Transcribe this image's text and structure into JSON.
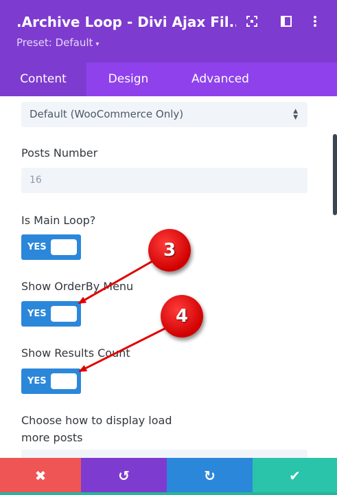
{
  "header": {
    "title": ".Archive Loop - Divi Ajax Fil...",
    "preset_label": "Preset: Default",
    "preset_caret": "▾",
    "icons": [
      "focus-icon",
      "sidebar-toggle-icon",
      "more-vertical-icon"
    ],
    "background": "#7e3bd0"
  },
  "tabs": [
    {
      "label": "Content",
      "active": true
    },
    {
      "label": "Design",
      "active": false
    },
    {
      "label": "Advanced",
      "active": false
    }
  ],
  "fields": {
    "source_select_value": "Default (WooCommerce Only)",
    "posts_number_label": "Posts Number",
    "posts_number_value": "16",
    "main_loop_label": "Is Main Loop?",
    "main_loop_toggle": "YES",
    "orderby_label": "Show OrderBy Menu",
    "orderby_toggle": "YES",
    "results_count_label": "Show Results Count",
    "results_count_toggle": "YES",
    "load_more_label_line1": "Choose how to display load",
    "load_more_label_line2": "more posts"
  },
  "annotations": [
    {
      "number": "3"
    },
    {
      "number": "4"
    }
  ],
  "bottom_bar": [
    {
      "name": "cancel",
      "icon": "✖",
      "color": "#ef5555"
    },
    {
      "name": "undo",
      "icon": "↺",
      "color": "#7e3bd0"
    },
    {
      "name": "redo",
      "icon": "↻",
      "color": "#2b87da"
    },
    {
      "name": "save",
      "icon": "✔",
      "color": "#29c4a9"
    }
  ],
  "colors": {
    "accent": "#2b87da",
    "tab_bar": "#8f42ec",
    "annotation": "#e00000"
  }
}
